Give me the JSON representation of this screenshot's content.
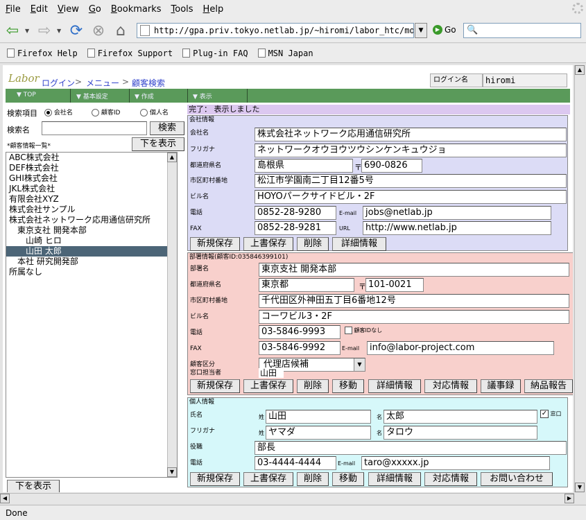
{
  "menubar": {
    "items": [
      "File",
      "Edit",
      "View",
      "Go",
      "Bookmarks",
      "Tools",
      "Help"
    ]
  },
  "nav": {
    "url": "http://gpa.priv.tokyo.netlab.jp/~hiromi/labor_htc/mor",
    "go_label": "Go"
  },
  "bookmarks": [
    "Firefox Help",
    "Firefox Support",
    "Plug-in FAQ",
    "MSN Japan"
  ],
  "page": {
    "logo": "Labor",
    "breadcrumb": [
      "ログイン",
      "メニュー",
      "顧客検索"
    ],
    "login_label": "ログイン名",
    "login_value": "hiromi",
    "green_menu": [
      "▼ TOP",
      "▼ 基本設定",
      "▼ 作成",
      "▼ 表示"
    ],
    "search": {
      "item_label": "検索項目",
      "radios": [
        "会社名",
        "顧客ID",
        "個人名"
      ],
      "name_label": "検索名",
      "button": "検索"
    },
    "list": {
      "title": "*顧客情報一覧*",
      "show_below": "下を表示",
      "items": [
        "ABC株式会社",
        "DEF株式会社",
        "GHI株式会社",
        "JKL株式会社",
        "有限会社XYZ",
        "株式会社サンプル",
        "株式会社ネットワーク応用通信研究所",
        "　東京支社 開発本部",
        "　　山崎 ヒロ",
        "　　山田 太郎",
        "　本社 研究開発部",
        "所属なし"
      ],
      "selected_index": 9,
      "bottom_button": "下を表示"
    },
    "status": "完了： 表示しました",
    "company": {
      "title": "会社情報",
      "name_label": "会社名",
      "name": "株式会社ネットワーク応用通信研究所",
      "kana_label": "フリガナ",
      "kana": "ネットワークオウヨウツウシンケンキュウジョ",
      "pref_label": "都道府県名",
      "pref": "島根県",
      "zip_mark": "〒",
      "zip": "690-0826",
      "city_label": "市区町村番地",
      "city": "松江市学園南二丁目12番5号",
      "bldg_label": "ビル名",
      "bldg": "HOYOパークサイドビル・2F",
      "tel_label": "電話",
      "tel": "0852-28-9280",
      "mail_label": "E-mail",
      "mail": "jobs@netlab.jp",
      "fax_label": "FAX",
      "fax": "0852-28-9281",
      "url_label": "URL",
      "url": "http://www.netlab.jp",
      "buttons": [
        "新規保存",
        "上書保存",
        "削除",
        "詳細情報"
      ]
    },
    "dept": {
      "title": "部署情報(顧客ID:035846399101)",
      "name_label": "部署名",
      "name": "東京支社 開発本部",
      "pref_label": "都道府県名",
      "pref": "東京都",
      "zip_mark": "〒",
      "zip": "101-0021",
      "city_label": "市区町村番地",
      "city": "千代田区外神田五丁目6番地12号",
      "bldg_label": "ビル名",
      "bldg": "コーワビル3・2F",
      "tel_label": "電話",
      "tel": "03-5846-9993",
      "noid_label": "顧客IDなし",
      "fax_label": "FAX",
      "fax": "03-5846-9992",
      "mail_label": "E-mail",
      "mail": "info@labor-project.com",
      "type_label": "顧客区分",
      "type": "代理店候補",
      "rep_label": "窓口担当者",
      "rep": "山田",
      "buttons": [
        "新規保存",
        "上書保存",
        "削除",
        "移動",
        "詳細情報",
        "対応情報",
        "議事録",
        "納品報告"
      ]
    },
    "person": {
      "title": "個人情報",
      "name_label": "氏名",
      "sei_mark": "姓",
      "sei": "山田",
      "mei_mark": "名",
      "mei": "太郎",
      "window_label": "窓口",
      "kana_label": "フリガナ",
      "sei_kana": "ヤマダ",
      "mei_kana": "タロウ",
      "post_label": "役職",
      "post": "部長",
      "tel_label": "電話",
      "tel": "03-4444-4444",
      "mail_label": "E-mail",
      "mail": "taro@xxxxx.jp",
      "buttons": [
        "新規保存",
        "上書保存",
        "削除",
        "移動",
        "詳細情報",
        "対応情報",
        "お問い合わせ"
      ]
    }
  },
  "statusbar": "Done",
  "colors": {
    "green": "#5a9a5a",
    "company_bg": "#dcdcf6",
    "dept_bg": "#f8d0cc",
    "person_bg": "#d6f8fa",
    "selected": "#4c6577"
  }
}
